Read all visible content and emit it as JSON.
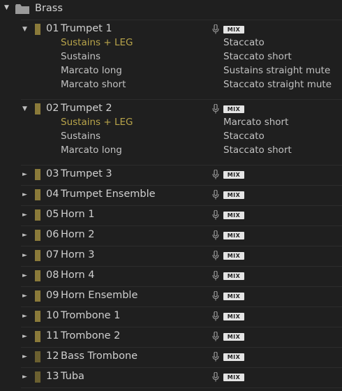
{
  "folder": {
    "label": "Brass"
  },
  "mix_label": "MIX",
  "tracks": [
    {
      "number": "01",
      "name": "Trumpet 1",
      "expanded": true,
      "articulations_left": [
        "Sustains + LEG",
        "Sustains",
        "Marcato long",
        "Marcato short"
      ],
      "articulations_right": [
        "Staccato",
        "Staccato short",
        "Sustains straight mute",
        "Staccato straight mute"
      ],
      "active_articulation": "Sustains + LEG"
    },
    {
      "number": "02",
      "name": "Trumpet 2",
      "expanded": true,
      "articulations_left": [
        "Sustains + LEG",
        "Sustains",
        "Marcato long"
      ],
      "articulations_right": [
        "Marcato short",
        "Staccato",
        "Staccato short"
      ],
      "active_articulation": "Sustains + LEG"
    },
    {
      "number": "03",
      "name": "Trumpet 3",
      "expanded": false
    },
    {
      "number": "04",
      "name": "Trumpet Ensemble",
      "expanded": false
    },
    {
      "number": "05",
      "name": "Horn 1",
      "expanded": false
    },
    {
      "number": "06",
      "name": "Horn 2",
      "expanded": false
    },
    {
      "number": "07",
      "name": "Horn 3",
      "expanded": false
    },
    {
      "number": "08",
      "name": "Horn 4",
      "expanded": false
    },
    {
      "number": "09",
      "name": "Horn Ensemble",
      "expanded": false
    },
    {
      "number": "10",
      "name": "Trombone 1",
      "expanded": false
    },
    {
      "number": "11",
      "name": "Trombone 2",
      "expanded": false
    },
    {
      "number": "12",
      "name": "Bass Trombone",
      "expanded": false
    },
    {
      "number": "13",
      "name": "Tuba",
      "expanded": false
    }
  ],
  "colors": {
    "track_swatch": "#8a7a3a",
    "track_swatch_dark": "#6b6030",
    "active_articulation": "#b8a44a"
  },
  "icons": {
    "expanded_caret": "triangle-down",
    "collapsed_caret": "triangle-right",
    "folder": "folder-icon",
    "mic": "mic-icon"
  }
}
